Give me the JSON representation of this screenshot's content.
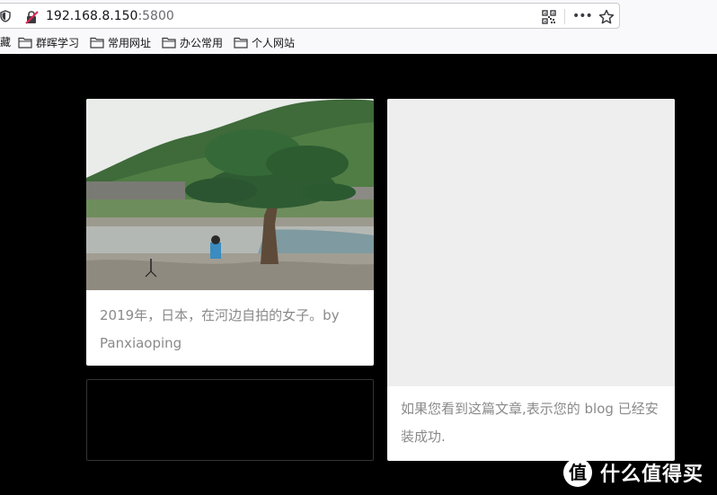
{
  "browser": {
    "url_host": "192.168.8.150",
    "url_port": ":5800",
    "icons": {
      "tracking": "shield-icon",
      "insecure": "insecure-lock-icon",
      "qr": "qr-code-icon",
      "menu": "more-icon",
      "bookmark_star": "star-icon"
    }
  },
  "bookmarks": {
    "cut_label": "藏",
    "items": [
      {
        "label": "群晖学习"
      },
      {
        "label": "常用网址"
      },
      {
        "label": "办公常用"
      },
      {
        "label": "个人网站"
      }
    ]
  },
  "page": {
    "cards": [
      {
        "caption": "2019年，日本，在河边自拍的女子。by Panxiaoping"
      },
      {
        "caption": "如果您看到这篇文章,表示您的 blog 已经安装成功."
      },
      {
        "caption": ""
      }
    ]
  },
  "watermark": {
    "text": "什么值得买"
  },
  "colors": {
    "page_bg": "#000000",
    "card_bg": "#ffffff",
    "caption_text": "#8a8a8a",
    "placeholder_bg": "#eeeeee"
  }
}
